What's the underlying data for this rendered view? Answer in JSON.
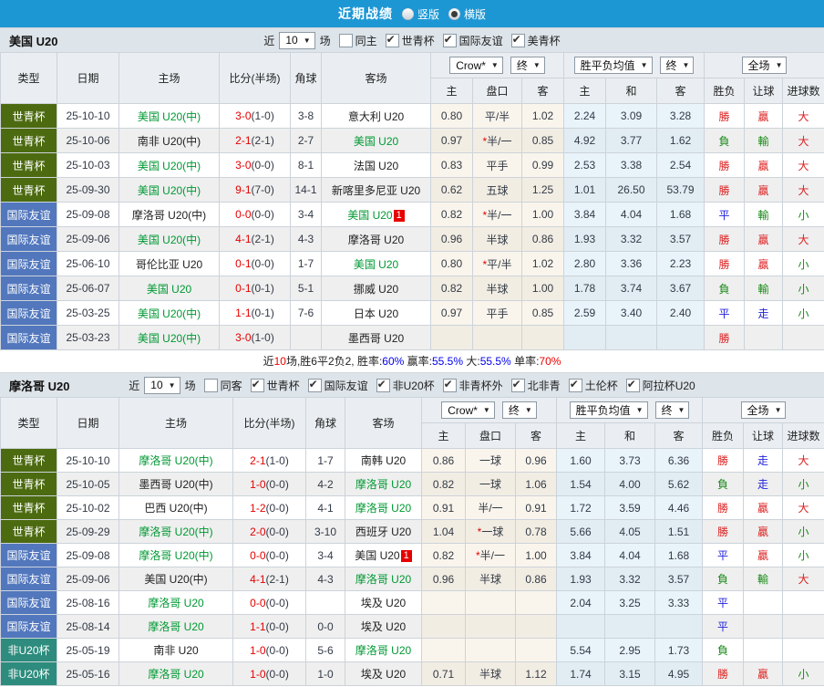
{
  "topbar": {
    "title": "近期战绩",
    "vertical_label": "竖版",
    "horizontal_label": "横版"
  },
  "table_header": {
    "cols": [
      "类型",
      "日期",
      "主场",
      "比分(半场)",
      "角球",
      "客场"
    ],
    "dropdowns": [
      "Crow*",
      "终",
      "胜平负均值",
      "终",
      "全场"
    ],
    "sub": [
      "主",
      "盘口",
      "客",
      "主",
      "和",
      "客",
      "胜负",
      "让球",
      "进球数"
    ]
  },
  "colors": {
    "topbar_bg": "#1d97d4",
    "section_bg": "#dde4ea",
    "header_bg": "#eaeef2",
    "row_alt": "#efefef",
    "border": "#ccd3da",
    "team_green": "#009933",
    "team_dark": "#222222",
    "score_red": "#e60000",
    "text_dark": "#333a46",
    "odds_bg": "#faf5ec",
    "odds_bg_alt": "#f2ede3",
    "mean_bg": "#e9f3fa",
    "mean_bg_alt": "#e2ecf3",
    "type_colors": {
      "世青杯": "#4c6b10",
      "国际友谊": "#5277bd",
      "非U20杯": "#2d8c7d"
    },
    "result_colors": {
      "勝": "#dd2222",
      "贏": "#dd2222",
      "大": "#dd2222",
      "負": "#1a8a1a",
      "輸": "#1a8a1a",
      "小": "#1a8a1a",
      "平": "#2222dd",
      "走": "#2222dd"
    }
  },
  "sections": [
    {
      "team": "美国 U20",
      "filters": {
        "near": "近",
        "count": "10",
        "games": "场",
        "same": "同主",
        "same_checked": false,
        "cups": [
          "世青杯",
          "国际友谊",
          "美青杯"
        ]
      },
      "rows": [
        {
          "type": "世青杯",
          "date": "25-10-10",
          "home": {
            "t": "美国 U20(中)",
            "g": true
          },
          "ft": "3-0",
          "ht": "(1-0)",
          "corner": "3-8",
          "away": {
            "t": "意大利 U20",
            "g": false
          },
          "odds": [
            "0.80",
            "平/半",
            "1.02"
          ],
          "means": [
            "2.24",
            "3.09",
            "3.28"
          ],
          "res": [
            "勝",
            "贏",
            "大"
          ]
        },
        {
          "type": "世青杯",
          "date": "25-10-06",
          "home": {
            "t": "南非 U20(中)",
            "g": false
          },
          "ft": "2-1",
          "ht": "(2-1)",
          "corner": "2-7",
          "away": {
            "t": "美国 U20",
            "g": true
          },
          "odds": [
            "0.97",
            "*半/一",
            "0.85"
          ],
          "means": [
            "4.92",
            "3.77",
            "1.62"
          ],
          "res": [
            "負",
            "輸",
            "大"
          ]
        },
        {
          "type": "世青杯",
          "date": "25-10-03",
          "home": {
            "t": "美国 U20(中)",
            "g": true
          },
          "ft": "3-0",
          "ht": "(0-0)",
          "corner": "8-1",
          "away": {
            "t": "法国 U20",
            "g": false
          },
          "odds": [
            "0.83",
            "平手",
            "0.99"
          ],
          "means": [
            "2.53",
            "3.38",
            "2.54"
          ],
          "res": [
            "勝",
            "贏",
            "大"
          ]
        },
        {
          "type": "世青杯",
          "date": "25-09-30",
          "home": {
            "t": "美国 U20(中)",
            "g": true
          },
          "ft": "9-1",
          "ht": "(7-0)",
          "corner": "14-1",
          "away": {
            "t": "新喀里多尼亚 U20",
            "g": false
          },
          "odds": [
            "0.62",
            "五球",
            "1.25"
          ],
          "means": [
            "1.01",
            "26.50",
            "53.79"
          ],
          "res": [
            "勝",
            "贏",
            "大"
          ]
        },
        {
          "type": "国际友谊",
          "date": "25-09-08",
          "home": {
            "t": "摩洛哥 U20(中)",
            "g": false
          },
          "ft": "0-0",
          "ht": "(0-0)",
          "corner": "3-4",
          "away": {
            "t": "美国 U20",
            "g": true,
            "badge": "1"
          },
          "odds": [
            "0.82",
            "*半/一",
            "1.00"
          ],
          "means": [
            "3.84",
            "4.04",
            "1.68"
          ],
          "res": [
            "平",
            "輸",
            "小"
          ]
        },
        {
          "type": "国际友谊",
          "date": "25-09-06",
          "home": {
            "t": "美国 U20(中)",
            "g": true
          },
          "ft": "4-1",
          "ht": "(2-1)",
          "corner": "4-3",
          "away": {
            "t": "摩洛哥 U20",
            "g": false
          },
          "odds": [
            "0.96",
            "半球",
            "0.86"
          ],
          "means": [
            "1.93",
            "3.32",
            "3.57"
          ],
          "res": [
            "勝",
            "贏",
            "大"
          ]
        },
        {
          "type": "国际友谊",
          "date": "25-06-10",
          "home": {
            "t": "哥伦比亚 U20",
            "g": false
          },
          "ft": "0-1",
          "ht": "(0-0)",
          "corner": "1-7",
          "away": {
            "t": "美国 U20",
            "g": true
          },
          "odds": [
            "0.80",
            "*平/半",
            "1.02"
          ],
          "means": [
            "2.80",
            "3.36",
            "2.23"
          ],
          "res": [
            "勝",
            "贏",
            "小"
          ]
        },
        {
          "type": "国际友谊",
          "date": "25-06-07",
          "home": {
            "t": "美国 U20",
            "g": true
          },
          "ft": "0-1",
          "ht": "(0-1)",
          "corner": "5-1",
          "away": {
            "t": "挪威 U20",
            "g": false
          },
          "odds": [
            "0.82",
            "半球",
            "1.00"
          ],
          "means": [
            "1.78",
            "3.74",
            "3.67"
          ],
          "res": [
            "負",
            "輸",
            "小"
          ]
        },
        {
          "type": "国际友谊",
          "date": "25-03-25",
          "home": {
            "t": "美国 U20(中)",
            "g": true
          },
          "ft": "1-1",
          "ht": "(0-1)",
          "corner": "7-6",
          "away": {
            "t": "日本 U20",
            "g": false
          },
          "odds": [
            "0.97",
            "平手",
            "0.85"
          ],
          "means": [
            "2.59",
            "3.40",
            "2.40"
          ],
          "res": [
            "平",
            "走",
            "小"
          ]
        },
        {
          "type": "国际友谊",
          "date": "25-03-23",
          "home": {
            "t": "美国 U20(中)",
            "g": true
          },
          "ft": "3-0",
          "ht": "(1-0)",
          "corner": "",
          "away": {
            "t": "墨西哥 U20",
            "g": false
          },
          "odds": [
            "",
            "",
            ""
          ],
          "means": [
            "",
            "",
            ""
          ],
          "res": [
            "勝",
            "",
            ""
          ]
        }
      ],
      "summary": [
        {
          "text": "近",
          "color": "#222222"
        },
        {
          "text": "10",
          "color": "#ee0000"
        },
        {
          "text": "场,胜6平2负2, 胜率:",
          "color": "#222222"
        },
        {
          "text": "60%",
          "color": "#0000ee"
        },
        {
          "text": " 赢率:",
          "color": "#222222"
        },
        {
          "text": "55.5%",
          "color": "#0000ee"
        },
        {
          "text": " 大:",
          "color": "#222222"
        },
        {
          "text": "55.5%",
          "color": "#0000ee"
        },
        {
          "text": " 单率:",
          "color": "#222222"
        },
        {
          "text": "70%",
          "color": "#ee0000"
        }
      ]
    },
    {
      "team": "摩洛哥 U20",
      "filters": {
        "near": "近",
        "count": "10",
        "games": "场",
        "same": "同客",
        "same_checked": false,
        "cups": [
          "世青杯",
          "国际友谊",
          "非U20杯",
          "非青杯外",
          "北非青",
          "土伦杯",
          "阿拉杯U20"
        ]
      },
      "rows": [
        {
          "type": "世青杯",
          "date": "25-10-10",
          "home": {
            "t": "摩洛哥 U20(中)",
            "g": true
          },
          "ft": "2-1",
          "ht": "(1-0)",
          "corner": "1-7",
          "away": {
            "t": "南韩 U20",
            "g": false
          },
          "odds": [
            "0.86",
            "一球",
            "0.96"
          ],
          "means": [
            "1.60",
            "3.73",
            "6.36"
          ],
          "res": [
            "勝",
            "走",
            "大"
          ]
        },
        {
          "type": "世青杯",
          "date": "25-10-05",
          "home": {
            "t": "墨西哥 U20(中)",
            "g": false
          },
          "ft": "1-0",
          "ht": "(0-0)",
          "corner": "4-2",
          "away": {
            "t": "摩洛哥 U20",
            "g": true
          },
          "odds": [
            "0.82",
            "一球",
            "1.06"
          ],
          "means": [
            "1.54",
            "4.00",
            "5.62"
          ],
          "res": [
            "負",
            "走",
            "小"
          ]
        },
        {
          "type": "世青杯",
          "date": "25-10-02",
          "home": {
            "t": "巴西 U20(中)",
            "g": false
          },
          "ft": "1-2",
          "ht": "(0-0)",
          "corner": "4-1",
          "away": {
            "t": "摩洛哥 U20",
            "g": true
          },
          "odds": [
            "0.91",
            "半/一",
            "0.91"
          ],
          "means": [
            "1.72",
            "3.59",
            "4.46"
          ],
          "res": [
            "勝",
            "贏",
            "大"
          ]
        },
        {
          "type": "世青杯",
          "date": "25-09-29",
          "home": {
            "t": "摩洛哥 U20(中)",
            "g": true
          },
          "ft": "2-0",
          "ht": "(0-0)",
          "corner": "3-10",
          "away": {
            "t": "西班牙 U20",
            "g": false
          },
          "odds": [
            "1.04",
            "*一球",
            "0.78"
          ],
          "means": [
            "5.66",
            "4.05",
            "1.51"
          ],
          "res": [
            "勝",
            "贏",
            "小"
          ]
        },
        {
          "type": "国际友谊",
          "date": "25-09-08",
          "home": {
            "t": "摩洛哥 U20(中)",
            "g": true
          },
          "ft": "0-0",
          "ht": "(0-0)",
          "corner": "3-4",
          "away": {
            "t": "美国 U20",
            "g": false,
            "badge": "1"
          },
          "odds": [
            "0.82",
            "*半/一",
            "1.00"
          ],
          "means": [
            "3.84",
            "4.04",
            "1.68"
          ],
          "res": [
            "平",
            "贏",
            "小"
          ]
        },
        {
          "type": "国际友谊",
          "date": "25-09-06",
          "home": {
            "t": "美国 U20(中)",
            "g": false
          },
          "ft": "4-1",
          "ht": "(2-1)",
          "corner": "4-3",
          "away": {
            "t": "摩洛哥 U20",
            "g": true
          },
          "odds": [
            "0.96",
            "半球",
            "0.86"
          ],
          "means": [
            "1.93",
            "3.32",
            "3.57"
          ],
          "res": [
            "負",
            "輸",
            "大"
          ]
        },
        {
          "type": "国际友谊",
          "date": "25-08-16",
          "home": {
            "t": "摩洛哥 U20",
            "g": true
          },
          "ft": "0-0",
          "ht": "(0-0)",
          "corner": "",
          "away": {
            "t": "埃及 U20",
            "g": false
          },
          "odds": [
            "",
            "",
            ""
          ],
          "means": [
            "2.04",
            "3.25",
            "3.33"
          ],
          "res": [
            "平",
            "",
            ""
          ]
        },
        {
          "type": "国际友谊",
          "date": "25-08-14",
          "home": {
            "t": "摩洛哥 U20",
            "g": true
          },
          "ft": "1-1",
          "ht": "(0-0)",
          "corner": "0-0",
          "away": {
            "t": "埃及 U20",
            "g": false
          },
          "odds": [
            "",
            "",
            ""
          ],
          "means": [
            "",
            "",
            ""
          ],
          "res": [
            "平",
            "",
            ""
          ]
        },
        {
          "type": "非U20杯",
          "date": "25-05-19",
          "home": {
            "t": "南非 U20",
            "g": false
          },
          "ft": "1-0",
          "ht": "(0-0)",
          "corner": "5-6",
          "away": {
            "t": "摩洛哥 U20",
            "g": true
          },
          "odds": [
            "",
            "",
            ""
          ],
          "means": [
            "5.54",
            "2.95",
            "1.73"
          ],
          "res": [
            "負",
            "",
            ""
          ]
        },
        {
          "type": "非U20杯",
          "date": "25-05-16",
          "home": {
            "t": "摩洛哥 U20",
            "g": true
          },
          "ft": "1-0",
          "ht": "(0-0)",
          "corner": "1-0",
          "away": {
            "t": "埃及 U20",
            "g": false
          },
          "odds": [
            "0.71",
            "半球",
            "1.12"
          ],
          "means": [
            "1.74",
            "3.15",
            "4.95"
          ],
          "res": [
            "勝",
            "贏",
            "小"
          ]
        }
      ]
    }
  ]
}
